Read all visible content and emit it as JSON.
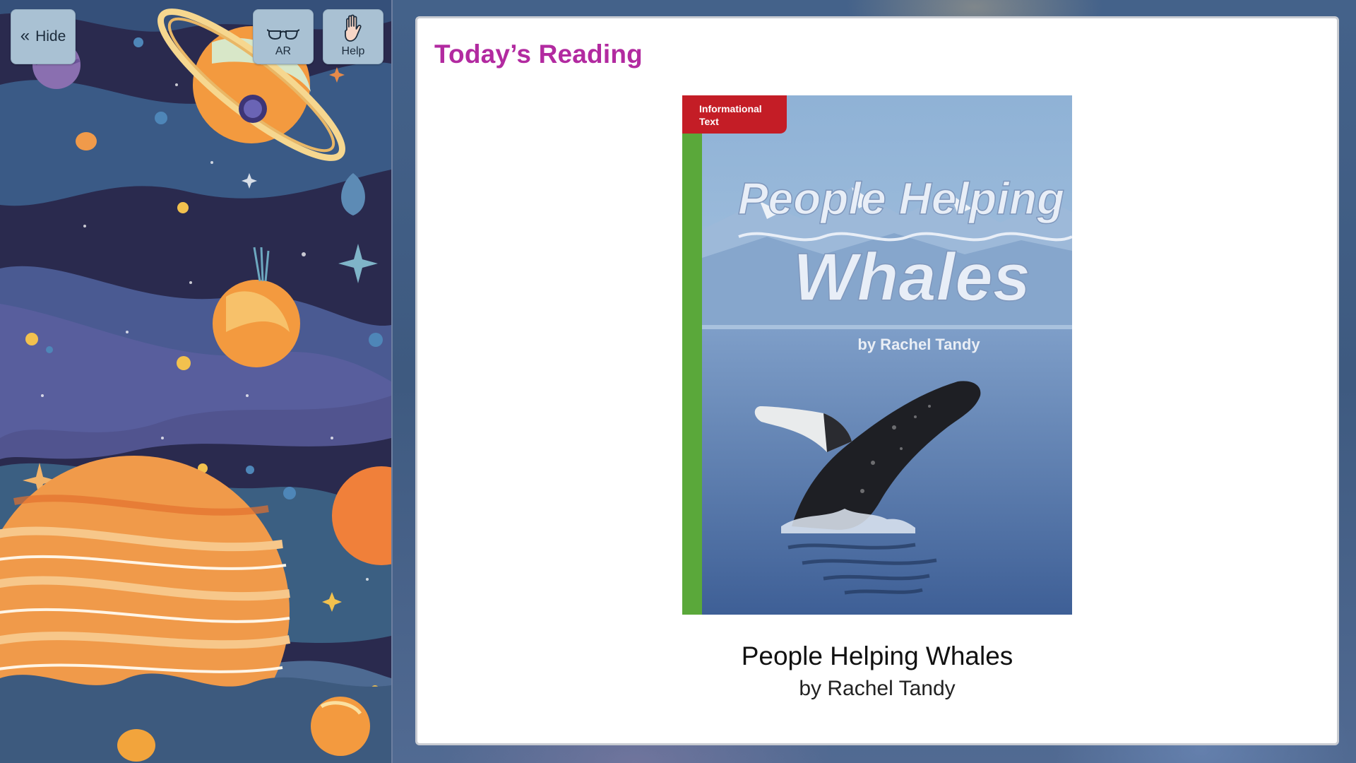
{
  "toolbar": {
    "hide_label": "Hide",
    "hide_icon": "double-chevron-left-icon",
    "ar_label": "AR",
    "ar_icon": "glasses-icon",
    "help_label": "Help",
    "help_icon": "raised-hand-icon"
  },
  "reading": {
    "heading": "Today’s Reading",
    "book_title": "People Helping Whales",
    "book_author": "by Rachel Tandy",
    "cover": {
      "badge_line1": "Informational",
      "badge_line2": "Text",
      "title_line1": "People Helping",
      "title_line2": "Whales",
      "byline": "by  Rachel  Tandy"
    }
  },
  "colors": {
    "heading": "#b22aa0",
    "button_bg": "#a9c1d3",
    "space_bg": "#2a2a4e",
    "badge_red": "#c41d26",
    "spine_green": "#5aa83a"
  }
}
